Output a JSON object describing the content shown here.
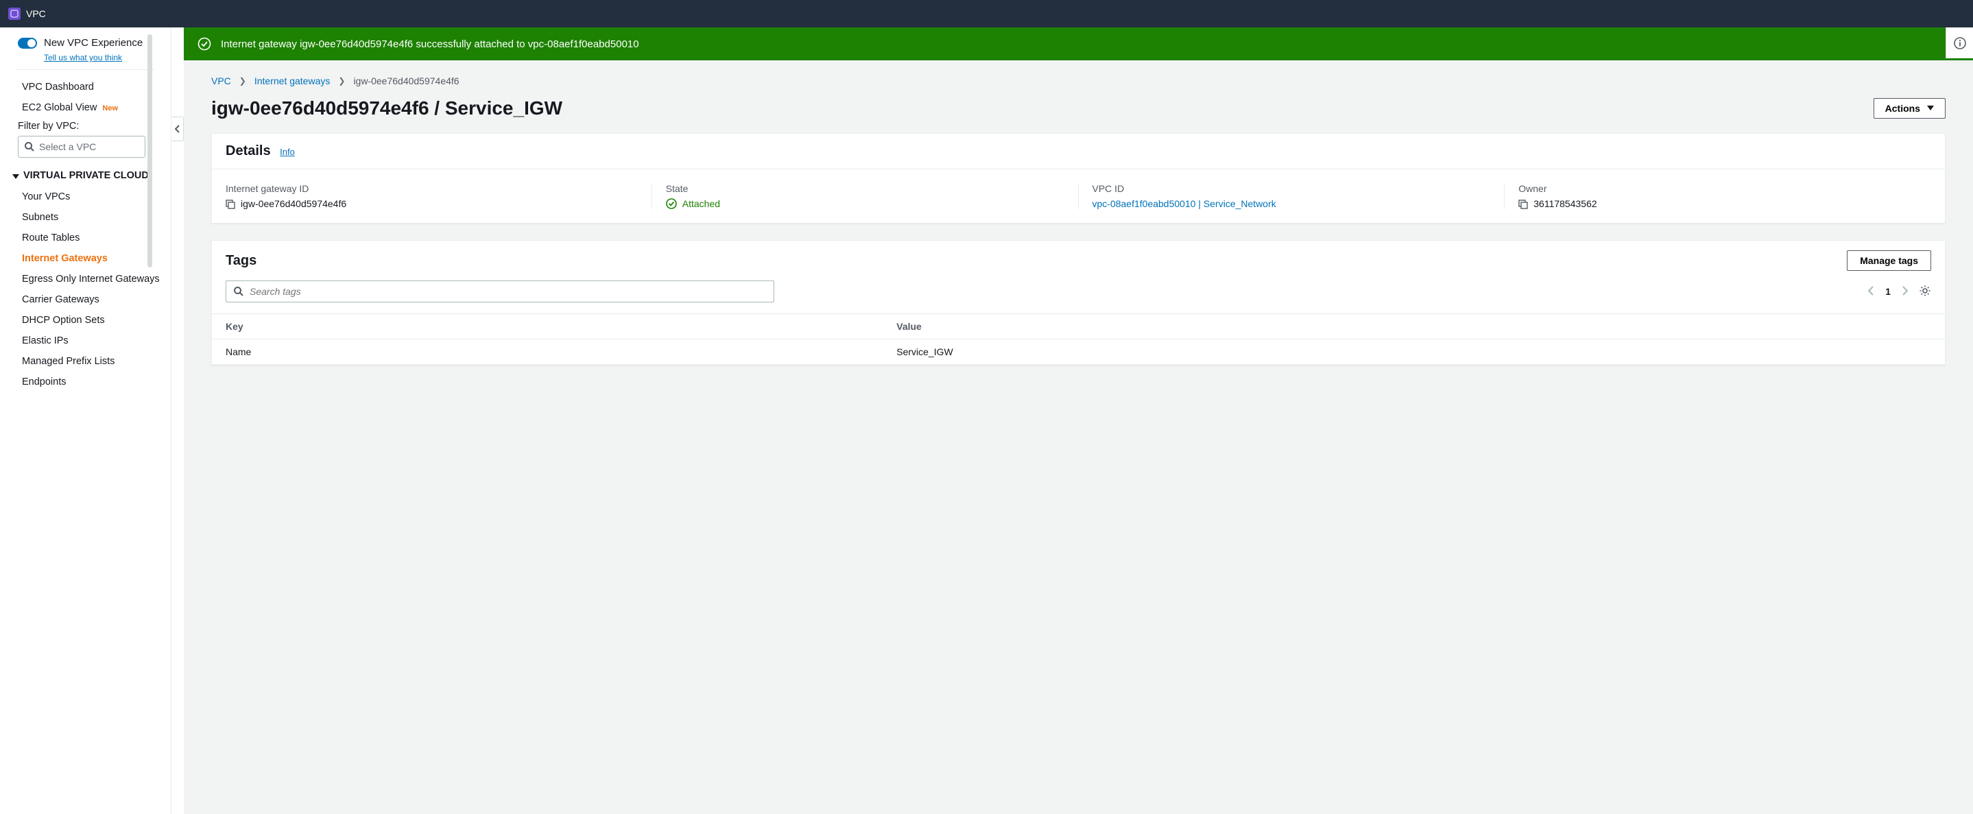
{
  "topbar": {
    "title": "VPC"
  },
  "sidebar": {
    "experience_label": "New VPC Experience",
    "experience_sub": "Tell us what you think",
    "dashboard": "VPC Dashboard",
    "ec2_global": "EC2 Global View",
    "new_badge": "New",
    "filter_label": "Filter by VPC:",
    "filter_placeholder": "Select a VPC",
    "section_vpc": "VIRTUAL PRIVATE CLOUD",
    "items": {
      "your_vpcs": "Your VPCs",
      "subnets": "Subnets",
      "route_tables": "Route Tables",
      "internet_gateways": "Internet Gateways",
      "egress_only": "Egress Only Internet Gateways",
      "carrier_gateways": "Carrier Gateways",
      "dhcp": "DHCP Option Sets",
      "elastic_ips": "Elastic IPs",
      "managed_prefix": "Managed Prefix Lists",
      "endpoints": "Endpoints"
    }
  },
  "banner": {
    "message": "Internet gateway igw-0ee76d40d5974e4f6 successfully attached to vpc-08aef1f0eabd50010"
  },
  "breadcrumb": {
    "vpc": "VPC",
    "igw": "Internet gateways",
    "current": "igw-0ee76d40d5974e4f6"
  },
  "page_title": "igw-0ee76d40d5974e4f6 / Service_IGW",
  "actions_label": "Actions",
  "details": {
    "heading": "Details",
    "info": "Info",
    "igw_id_label": "Internet gateway ID",
    "igw_id_value": "igw-0ee76d40d5974e4f6",
    "state_label": "State",
    "state_value": "Attached",
    "vpc_label": "VPC ID",
    "vpc_value": "vpc-08aef1f0eabd50010 | Service_Network",
    "owner_label": "Owner",
    "owner_value": "361178543562"
  },
  "tags": {
    "heading": "Tags",
    "manage_label": "Manage tags",
    "search_placeholder": "Search tags",
    "page": "1",
    "columns": {
      "key": "Key",
      "value": "Value"
    },
    "rows": [
      {
        "key": "Name",
        "value": "Service_IGW"
      }
    ]
  },
  "colors": {
    "accent_orange": "#ec7211",
    "link_blue": "#0073bb",
    "success_green": "#1d8102"
  }
}
